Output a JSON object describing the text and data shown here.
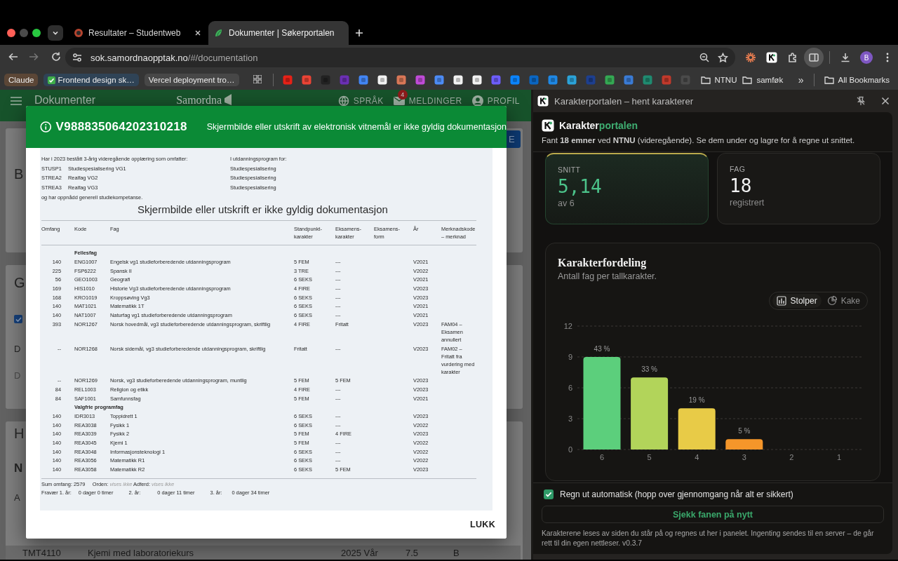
{
  "browser": {
    "tabs": [
      {
        "title": "Resultater – Studentweb",
        "selected": false,
        "closable": true
      },
      {
        "title": "Dokumenter | Søkerportalen",
        "selected": true,
        "closable": false
      }
    ],
    "url_host": "sok.samordnaopptak.no",
    "url_path": "/#/documentation",
    "profile_initial": "B",
    "bookmarks": [
      {
        "kind": "chip",
        "label": "Claude",
        "color": "#5b4636"
      },
      {
        "kind": "check-chip",
        "label": "Frontend design sk…",
        "color": "#2f4356"
      },
      {
        "kind": "chip",
        "label": "Vercel deployment tro…",
        "color": "#474747"
      }
    ],
    "folders": [
      {
        "label": "NTNU"
      },
      {
        "label": "samføk"
      }
    ],
    "overflow": "»",
    "all_bookmarks": "All Bookmarks"
  },
  "page_behind": {
    "header": {
      "title": "Dokumenter",
      "logo": "Samordna",
      "language": "SPRÅK",
      "messages": "MELDINGER",
      "message_count": "4",
      "profile": "PROFIL"
    },
    "button_fragment": "E",
    "cards": [
      {
        "items": [
          {
            "kind": "heading",
            "text": "B"
          }
        ]
      },
      {
        "items": [
          {
            "kind": "heading",
            "text": "G"
          },
          {
            "kind": "checkbox",
            "checked": true
          },
          {
            "kind": "line",
            "text": "D"
          },
          {
            "kind": "faint-line",
            "text": "D"
          }
        ]
      },
      {
        "items": [
          {
            "kind": "heading",
            "text": "H"
          },
          {
            "kind": "bold",
            "text": "N"
          },
          {
            "kind": "line",
            "text": "A"
          }
        ]
      }
    ],
    "bottom_row": [
      "TMT4110",
      "Kjemi med laboratoriekurs",
      "2025 Vår",
      "7.5",
      "B"
    ]
  },
  "modal": {
    "id": "V988835064202310218",
    "message": "Skjermbilde eller utskrift av elektronisk vitnemål er ikke gyldig dokumentasjon",
    "overlay_text": "Skjermbilde eller utskrift er ikke gyldig dokumentasjon",
    "document": {
      "intro": "Har i 2023 bestått 3-årig videregående opplæring som omfatter:",
      "programs": [
        {
          "code": "STUSP1",
          "name": "Studiespesialisering VG1"
        },
        {
          "code": "STREA2",
          "name": "Realfag VG2"
        },
        {
          "code": "STREA3",
          "name": "Realfag VG3"
        }
      ],
      "closing": "og har oppnådd generell studiekompetanse.",
      "program_heading": "I utdanningsprogram for:",
      "program_names": [
        "Studiespesialisering",
        "Studiespesialisering",
        "Studiespesialisering"
      ],
      "columns": [
        "Omfang",
        "Kode",
        "Fag",
        "Standpunkt-\nkarakter",
        "Eksamens-\nkarakter",
        "Eksamens-\nform",
        "År",
        "Merknadskode\n– merknad"
      ],
      "groups": [
        {
          "title": "Fellesfag",
          "rows": [
            {
              "omfang": "140",
              "code": "ENG1007",
              "subject": "Engelsk vg1 studieforberedende utdanningsprogram",
              "standpunkt": "5 FEM",
              "exam": "---",
              "year": "V2021"
            },
            {
              "omfang": "225",
              "code": "FSP6222",
              "subject": "Spansk II",
              "standpunkt": "3 TRE",
              "exam": "---",
              "year": "V2022"
            },
            {
              "omfang": "56",
              "code": "GEO1003",
              "subject": "Geografi",
              "standpunkt": "6 SEKS",
              "exam": "---",
              "year": "V2021"
            },
            {
              "omfang": "169",
              "code": "HIS1010",
              "subject": "Historie Vg3 studieforberedende utdanningsprogram",
              "standpunkt": "4 FIRE",
              "exam": "---",
              "year": "V2023"
            },
            {
              "omfang": "168",
              "code": "KRO1019",
              "subject": "Kroppsøving Vg3",
              "standpunkt": "6 SEKS",
              "exam": "---",
              "year": "V2023"
            },
            {
              "omfang": "140",
              "code": "MAT1021",
              "subject": "Matematikk 1T",
              "standpunkt": "6 SEKS",
              "exam": "---",
              "year": "V2021"
            },
            {
              "omfang": "140",
              "code": "NAT1007",
              "subject": "Naturfag vg1 studieforberedende utdanningsprogram",
              "standpunkt": "6 SEKS",
              "exam": "---",
              "year": "V2021"
            },
            {
              "omfang": "393",
              "code": "NOR1267",
              "subject": "Norsk hovedmål, vg3 studieforberedende utdanningsprogram, skriftlig",
              "standpunkt": "4 FIRE",
              "exam": "Fritatt",
              "year": "V2023",
              "note": "FAM04 – Eksamen annullert"
            },
            {
              "omfang": "--",
              "code": "NOR1268",
              "subject": "Norsk sidemål, vg3 studieforberedende utdanningsprogram, skriftlig",
              "standpunkt": "Fritatt",
              "exam": "---",
              "year": "V2023",
              "note": "FAM02 – Fritatt fra vurdering med karakter"
            },
            {
              "omfang": "--",
              "code": "NOR1269",
              "subject": "Norsk, vg3 studieforberedende utdanningsprogram, muntlig",
              "standpunkt": "5 FEM",
              "exam": "5 FEM",
              "year": "V2023"
            },
            {
              "omfang": "84",
              "code": "REL1003",
              "subject": "Religion og etikk",
              "standpunkt": "4 FIRE",
              "exam": "---",
              "year": "V2023"
            },
            {
              "omfang": "84",
              "code": "SAF1001",
              "subject": "Samfunnsfag",
              "standpunkt": "5 FEM",
              "exam": "---",
              "year": "V2021"
            }
          ]
        },
        {
          "title": "Valgfrie programfag",
          "rows": [
            {
              "omfang": "140",
              "code": "IDR3013",
              "subject": "Toppidrett 1",
              "standpunkt": "6 SEKS",
              "exam": "---",
              "year": "V2023"
            },
            {
              "omfang": "140",
              "code": "REA3038",
              "subject": "Fysikk 1",
              "standpunkt": "6 SEKS",
              "exam": "---",
              "year": "V2022"
            },
            {
              "omfang": "140",
              "code": "REA3039",
              "subject": "Fysikk 2",
              "standpunkt": "5 FEM",
              "exam": "4 FIRE",
              "year": "V2023"
            },
            {
              "omfang": "140",
              "code": "REA3045",
              "subject": "Kjemi 1",
              "standpunkt": "5 FEM",
              "exam": "---",
              "year": "V2022"
            },
            {
              "omfang": "140",
              "code": "REA3048",
              "subject": "Informasjonsteknologi 1",
              "standpunkt": "6 SEKS",
              "exam": "---",
              "year": "V2022"
            },
            {
              "omfang": "140",
              "code": "REA3056",
              "subject": "Matematikk R1",
              "standpunkt": "6 SEKS",
              "exam": "---",
              "year": "V2022"
            },
            {
              "omfang": "140",
              "code": "REA3058",
              "subject": "Matematikk R2",
              "standpunkt": "6 SEKS",
              "exam": "5 FEM",
              "year": "V2023"
            }
          ]
        }
      ],
      "summary": {
        "sum": "Sum omfang: 2579",
        "orden_label": "Orden:",
        "orden": "vises ikke",
        "adferd_label": "Adferd:",
        "adferd": "vises ikke"
      },
      "absence": [
        {
          "label": "Fravær 1. år:",
          "value": "0 dager 0 timer"
        },
        {
          "label": "2. år:",
          "value": "0 dager 11 timer"
        },
        {
          "label": "3. år:",
          "value": "0 dager 34 timer"
        }
      ]
    },
    "close": "LUKK"
  },
  "panel": {
    "title": "Karakterportalen – hent karakterer",
    "brand": {
      "name": "Karakter",
      "accent": "portalen"
    },
    "intro": "Fant **18 emner** ved **NTNU** (videregående). Se dem under og lagre for å regne ut snittet.",
    "stats": [
      {
        "label": "SNITT",
        "value": "5,14",
        "sub": "av 6",
        "highlight": true
      },
      {
        "label": "FAG",
        "value": "18",
        "sub": "registrert",
        "highlight": false
      }
    ],
    "chart": {
      "title": "Karakterfordeling",
      "subtitle": "Antall fag per tallkarakter.",
      "views": [
        {
          "label": "Stolper",
          "kind": "bar",
          "selected": true
        },
        {
          "label": "Kake",
          "kind": "pie",
          "selected": false
        }
      ],
      "chart_data": {
        "type": "bar",
        "categories": [
          "6",
          "5",
          "4",
          "3",
          "2",
          "1"
        ],
        "series": [
          {
            "values": [
              9,
              7,
              4,
              1,
              0,
              0
            ]
          }
        ],
        "grid": true,
        "colors": [
          "#5ccf7c",
          "#b2d45a",
          "#e8cb47",
          "#f5962a"
        ],
        "ylim": [
          0,
          12
        ],
        "yticks": [
          0,
          3,
          6,
          9,
          12
        ],
        "value_labels": [
          "43 %",
          "33 %",
          "19 %",
          "5 %",
          null,
          null
        ]
      }
    },
    "auto": {
      "label": "Regn ut automatisk (hopp over gjennomgang når alt er sikkert)",
      "checked": true
    },
    "recheck": "Sjekk fanen på nytt",
    "footnote": "Karakterene leses av siden du står på og regnes ut her i panelet. Ingenting sendes til en server – de går rett til din egen nettleser. v0.3.7"
  }
}
